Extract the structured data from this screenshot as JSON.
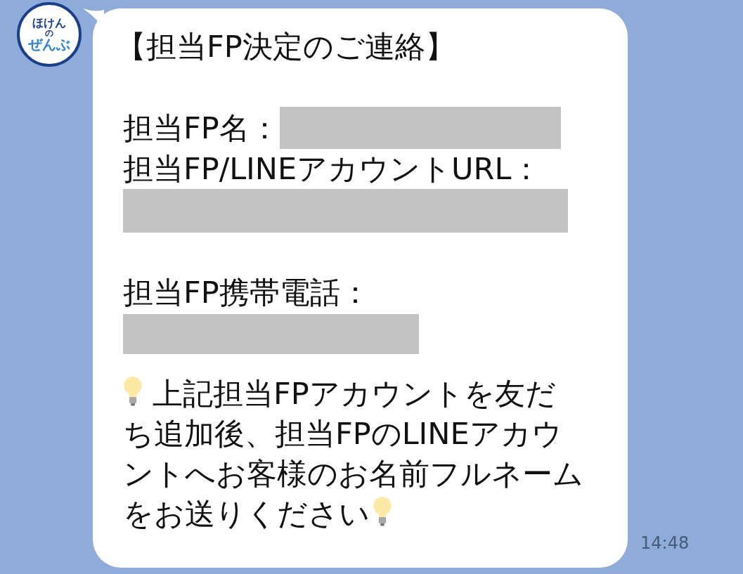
{
  "avatar": {
    "lines": [
      "ほけん",
      "の",
      "ぜんぶ"
    ]
  },
  "message": {
    "sections": [
      [
        {
          "kind": "heading",
          "text": "【担当FP決定のご連絡】"
        }
      ],
      [
        {
          "kind": "label",
          "text": "担当FP名：",
          "redacted": true
        },
        {
          "kind": "label",
          "text": "担当FP/LINEアカウントURL："
        },
        {
          "kind": "redaction"
        }
      ],
      [
        {
          "kind": "label",
          "text": "担当FP携帯電話："
        },
        {
          "kind": "redaction"
        }
      ],
      [
        {
          "kind": "note",
          "text": "上記担当FPアカウントを友だち追加後、担当FPのLINEアカウントへお客様のお名前フルネームをお送りください"
        }
      ]
    ]
  },
  "time": "14:48"
}
